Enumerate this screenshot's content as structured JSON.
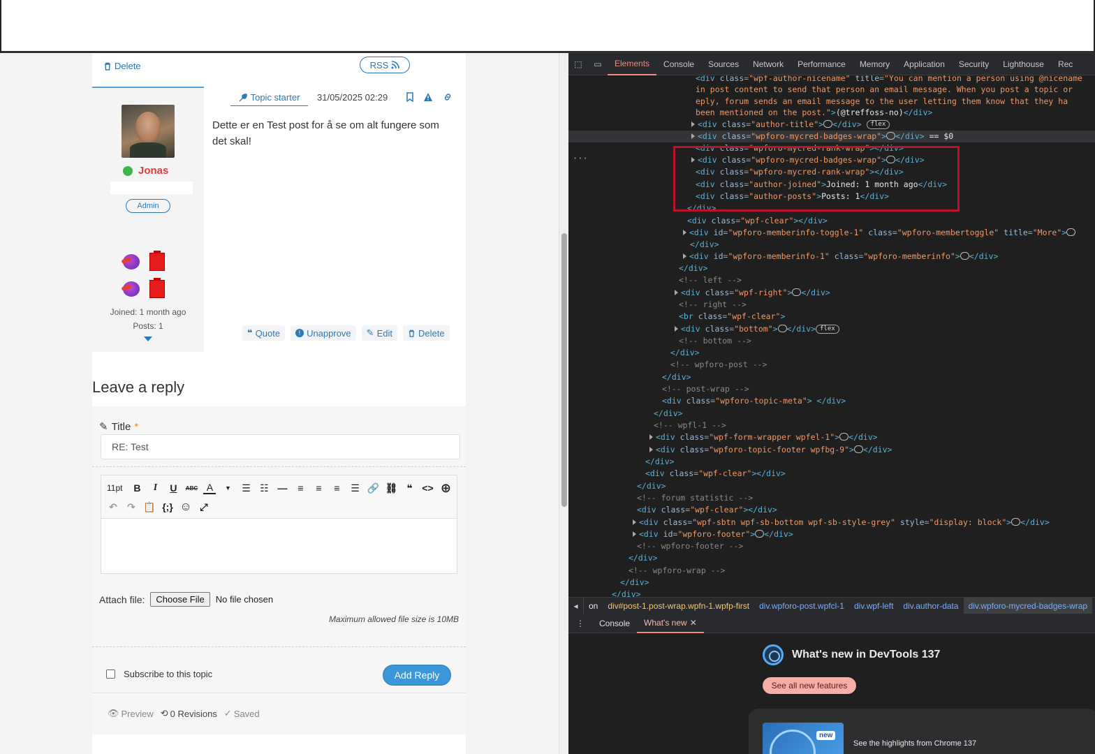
{
  "forum": {
    "top_delete": "Delete",
    "rss": "RSS",
    "author": {
      "name": "Jonas",
      "role": "Admin",
      "joined": "Joined: 1 month ago",
      "posts": "Posts: 1"
    },
    "post": {
      "topic_starter": "Topic starter",
      "date": "31/05/2025 02:29",
      "text": "Dette er en Test post for å se om alt fungere som det skal!"
    },
    "actions": [
      "Quote",
      "Unapprove",
      "Edit",
      "Delete"
    ],
    "reply": {
      "heading": "Leave a reply",
      "title_label": "Title",
      "title_required": "*",
      "title_value": "RE: Test",
      "toolbar_fontsize": "11pt",
      "attach_label": "Attach file:",
      "choose_file": "Choose File",
      "no_file": "No file chosen",
      "max_size": "Maximum allowed file size is 10MB",
      "subscribe": "Subscribe to this topic",
      "add_reply": "Add Reply",
      "preview": "Preview",
      "revisions": "0 Revisions",
      "saved": "Saved"
    }
  },
  "devtools": {
    "tabs": [
      "Elements",
      "Console",
      "Sources",
      "Network",
      "Performance",
      "Memory",
      "Application",
      "Security",
      "Lighthouse",
      "Rec"
    ],
    "active_tab": "Elements",
    "breadcrumb": [
      "on",
      "div#post-1.post-wrap.wpfn-1.wpfp-first",
      "div.wpforo-post.wpfcl-1",
      "div.wpf-left",
      "div.author-data",
      "div.wpforo-mycred-badges-wrap"
    ],
    "drawer_tabs": [
      "Console",
      "What's new"
    ],
    "whats_new": {
      "title": "What's new in DevTools 137",
      "button": "See all new features",
      "badge": "new",
      "card_text": "See the highlights from Chrome 137"
    }
  },
  "colors": {
    "accent": "#2a7ab8",
    "username": "#e03c3c",
    "devtools_bg": "#1f1f1f",
    "highlight": "#b8132b"
  }
}
